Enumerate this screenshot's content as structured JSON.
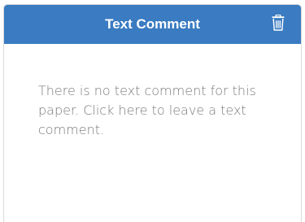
{
  "panel": {
    "title": "Text Comment",
    "delete_icon": "trash-icon",
    "header_color": "#3a7bc1",
    "empty_message": "There is no text comment for this paper. Click here to leave a text comment."
  }
}
